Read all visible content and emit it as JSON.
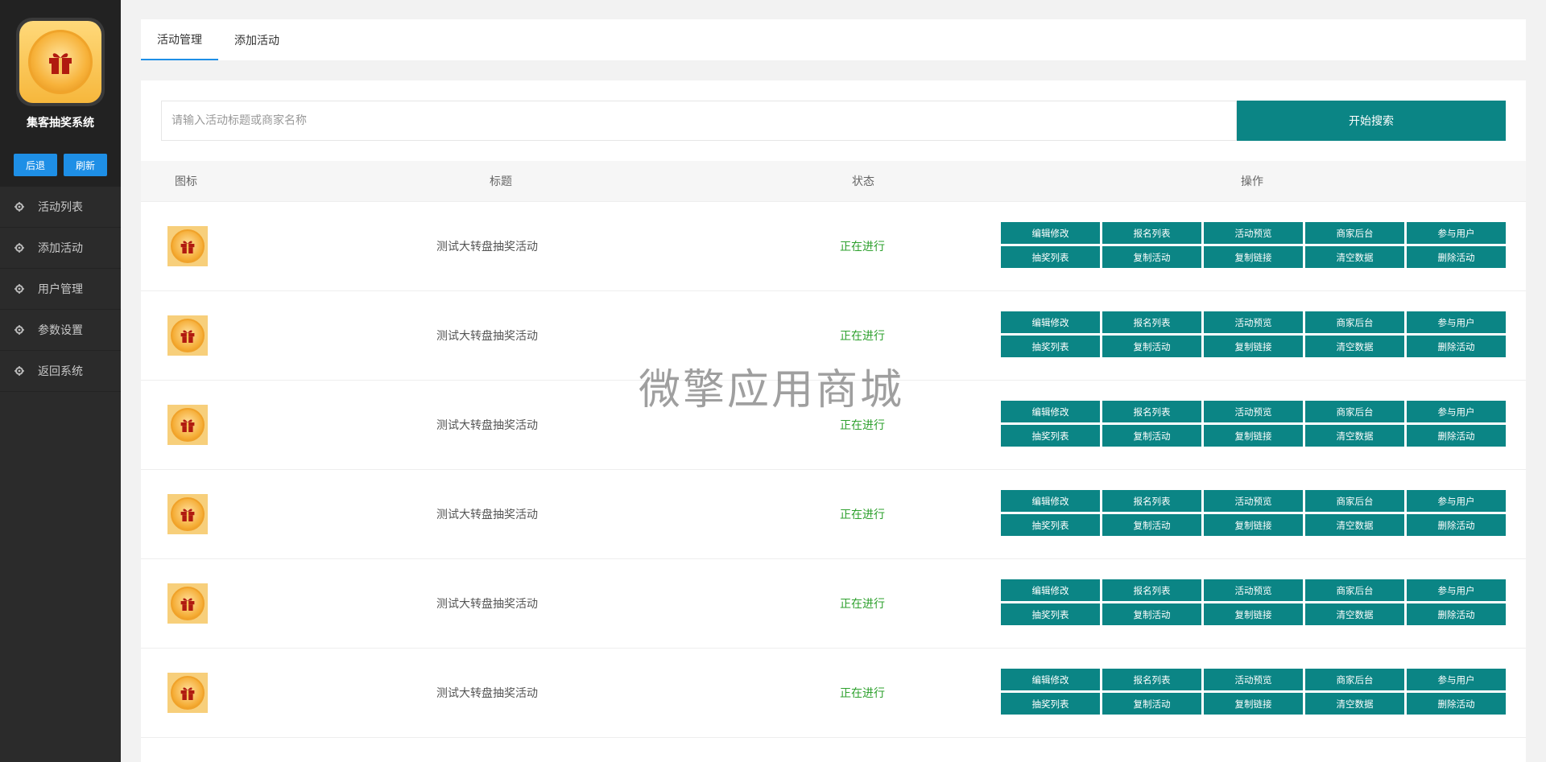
{
  "app": {
    "name": "集客抽奖系统"
  },
  "sidebar": {
    "buttons": {
      "back": "后退",
      "refresh": "刷新"
    },
    "items": [
      {
        "label": "活动列表",
        "icon": "gear-icon"
      },
      {
        "label": "添加活动",
        "icon": "gear-icon"
      },
      {
        "label": "用户管理",
        "icon": "gear-icon"
      },
      {
        "label": "参数设置",
        "icon": "gear-icon"
      },
      {
        "label": "返回系统",
        "icon": "gear-icon"
      }
    ]
  },
  "tabs": [
    {
      "label": "活动管理",
      "active": true
    },
    {
      "label": "添加活动",
      "active": false
    }
  ],
  "search": {
    "placeholder": "请输入活动标题或商家名称",
    "value": "",
    "button": "开始搜索"
  },
  "table": {
    "headers": {
      "icon": "图标",
      "title": "标题",
      "status": "状态",
      "ops": "操作"
    },
    "rows": [
      {
        "title": "测试大转盘抽奖活动",
        "status": "正在进行"
      },
      {
        "title": "测试大转盘抽奖活动",
        "status": "正在进行"
      },
      {
        "title": "测试大转盘抽奖活动",
        "status": "正在进行"
      },
      {
        "title": "测试大转盘抽奖活动",
        "status": "正在进行"
      },
      {
        "title": "测试大转盘抽奖活动",
        "status": "正在进行"
      },
      {
        "title": "测试大转盘抽奖活动",
        "status": "正在进行"
      }
    ],
    "actions": [
      "编辑修改",
      "报名列表",
      "活动预览",
      "商家后台",
      "参与用户",
      "抽奖列表",
      "复制活动",
      "复制链接",
      "清空数据",
      "删除活动"
    ]
  },
  "watermark": "微擎应用商城",
  "colors": {
    "accent": "#0b8585",
    "primary_blue": "#1e8fe6",
    "status_green": "#2ea12e",
    "sidebar_bg": "#2b2b2b"
  }
}
